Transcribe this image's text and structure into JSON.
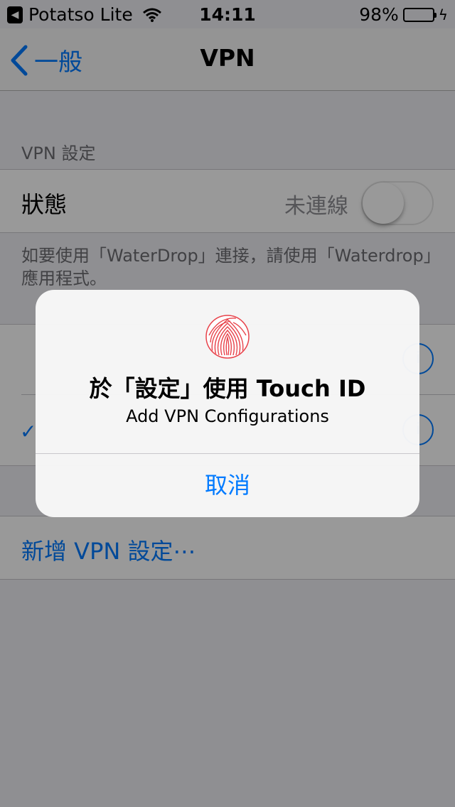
{
  "status_bar": {
    "carrier_app": "Potatso Lite",
    "time": "14:11",
    "battery": "98%",
    "battery_level": 0.98
  },
  "nav": {
    "back_label": "一般",
    "title": "VPN"
  },
  "vpn": {
    "section_header": "VPN 設定",
    "status_label": "狀態",
    "status_value": "未連線",
    "toggle_on": false,
    "footer_note": "如要使用「WaterDrop」連接，請使用「Waterdrop」應用程式。",
    "add_config": "新增 VPN 設定⋯"
  },
  "alert": {
    "title": "於「設定」使用 Touch ID",
    "message": "Add VPN Configurations",
    "cancel": "取消"
  },
  "colors": {
    "accent": "#007aff",
    "battery_fill": "#4cd964",
    "fingerprint": "#e8434b"
  }
}
